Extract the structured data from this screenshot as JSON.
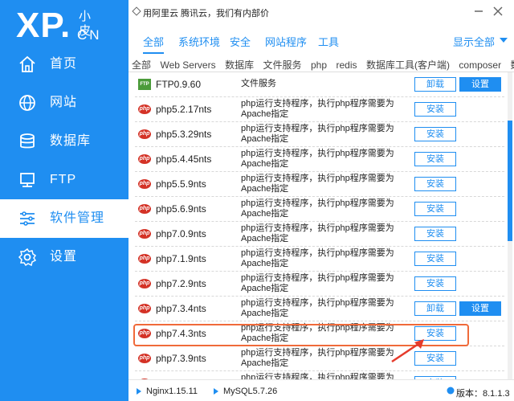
{
  "brand": {
    "xp": "XP.",
    "small": "小皮",
    "cn": "CN"
  },
  "sidebar": {
    "items": [
      {
        "label": "首页",
        "icon": "home-icon"
      },
      {
        "label": "网站",
        "icon": "globe-icon"
      },
      {
        "label": "数据库",
        "icon": "database-icon"
      },
      {
        "label": "FTP",
        "icon": "server-icon"
      },
      {
        "label": "软件管理",
        "icon": "sliders-icon",
        "active": true
      },
      {
        "label": "设置",
        "icon": "gear-icon"
      }
    ]
  },
  "titlebar": {
    "message": "用阿里云 腾讯云，我们有内部价"
  },
  "category_tabs": {
    "items": [
      "全部",
      "系统环境",
      "安全",
      "网站程序",
      "工具"
    ],
    "show_all": "显示全部"
  },
  "sub_tabs": [
    "全部",
    "Web Servers",
    "数据库",
    "文件服务",
    "php",
    "redis",
    "数据库工具(客户端)",
    "composer",
    "数据库工具"
  ],
  "rows": [
    {
      "name": "FTP0.9.60",
      "desc": "文件服务",
      "logo": "ftp",
      "installed": true
    },
    {
      "name": "php5.2.17nts",
      "desc": "php运行支持程序，执行php程序需要为Apache指定",
      "logo": "php",
      "installed": false
    },
    {
      "name": "php5.3.29nts",
      "desc": "php运行支持程序，执行php程序需要为Apache指定",
      "logo": "php",
      "installed": false
    },
    {
      "name": "php5.4.45nts",
      "desc": "php运行支持程序，执行php程序需要为Apache指定",
      "logo": "php",
      "installed": false
    },
    {
      "name": "php5.5.9nts",
      "desc": "php运行支持程序，执行php程序需要为Apache指定",
      "logo": "php",
      "installed": false
    },
    {
      "name": "php5.6.9nts",
      "desc": "php运行支持程序，执行php程序需要为Apache指定",
      "logo": "php",
      "installed": false
    },
    {
      "name": "php7.0.9nts",
      "desc": "php运行支持程序，执行php程序需要为Apache指定",
      "logo": "php",
      "installed": false
    },
    {
      "name": "php7.1.9nts",
      "desc": "php运行支持程序，执行php程序需要为Apache指定",
      "logo": "php",
      "installed": false
    },
    {
      "name": "php7.2.9nts",
      "desc": "php运行支持程序，执行php程序需要为Apache指定",
      "logo": "php",
      "installed": false
    },
    {
      "name": "php7.3.4nts",
      "desc": "php运行支持程序，执行php程序需要为Apache指定",
      "logo": "php",
      "installed": true
    },
    {
      "name": "php7.4.3nts",
      "desc": "php运行支持程序，执行php程序需要为Apache指定",
      "logo": "php",
      "installed": false
    },
    {
      "name": "php7.3.9nts",
      "desc": "php运行支持程序，执行php程序需要为Apache指定",
      "logo": "php",
      "installed": false
    },
    {
      "name": "",
      "desc": "php运行支持程序，执行php程序需要为Apache指定",
      "logo": "php",
      "installed": false
    }
  ],
  "buttons": {
    "install": "安装",
    "uninstall": "卸载",
    "settings": "设置"
  },
  "logo_text": {
    "php": "php",
    "ftp": "FTP"
  },
  "statusbar": {
    "nginx": "Nginx1.15.11",
    "mysql": "MySQL5.7.26",
    "version": "版本：8.1.1.3"
  },
  "colors": {
    "brand_blue": "#1f8ef1",
    "highlight": "#f06a3a",
    "arrow": "#e53b2c"
  }
}
